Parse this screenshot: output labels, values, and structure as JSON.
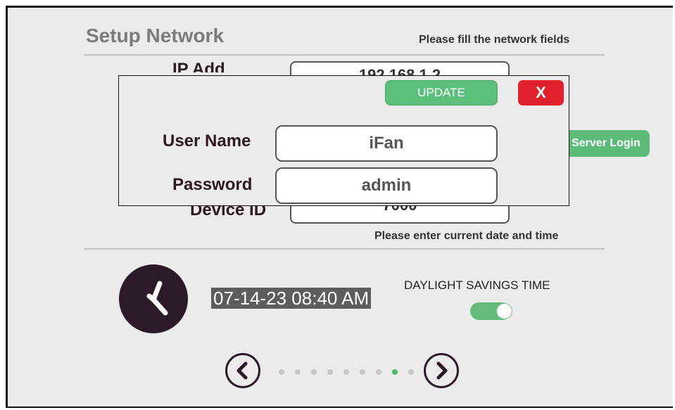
{
  "header": {
    "title": "Setup Network",
    "network_hint": "Please fill the network fields",
    "datetime_hint": "Please enter current date and time"
  },
  "background_form": {
    "ip_label": "IP Add",
    "ip_value": "192.168.1.2",
    "device_id_label": "Device ID",
    "device_id_value": "7000",
    "server_login_label": "Server Login"
  },
  "login_dialog": {
    "update_label": "UPDATE",
    "close_label": "X",
    "username_label": "User Name",
    "username_value": "iFan",
    "password_label": "Password",
    "password_value": "admin"
  },
  "datetime": {
    "value": "07-14-23 08:40 AM",
    "dst_label": "DAYLIGHT SAVINGS TIME",
    "dst_enabled": true
  },
  "pager": {
    "page_count": 9,
    "active_page": 8
  },
  "colors": {
    "accent_green": "#5cc07c",
    "close_red": "#e0202b",
    "dark_plum": "#2d1a28"
  }
}
